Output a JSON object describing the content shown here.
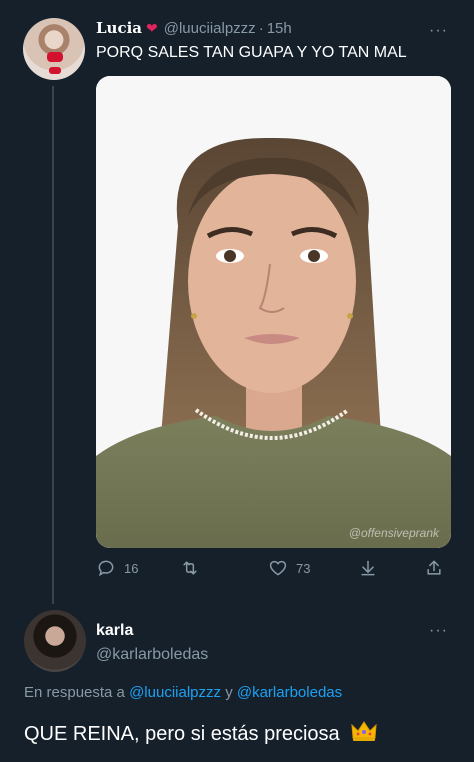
{
  "tweet": {
    "display_name": "Lucia",
    "handle": "@luuciialpzzz",
    "separator": "·",
    "time": "15h",
    "more": "···",
    "text": "PORQ SALES TAN GUAPA Y YO TAN MAL",
    "watermark": "@offensiveprank"
  },
  "actions": {
    "replies": "16",
    "likes": "73"
  },
  "reply": {
    "display_name": "karla",
    "handle": "@karlarboledas",
    "more": "···",
    "in_reply_prefix": "En respuesta a",
    "mention1": "@luuciialpzzz",
    "conjunction": "y",
    "mention2": "@karlarboledas",
    "text": "QUE REINA, pero si estás preciosa"
  },
  "colors": {
    "background": "#15202b",
    "secondary_text": "#8899a6",
    "link": "#1da1f2",
    "thread_line": "#38444d"
  },
  "icons": [
    "heart-emoji-icon",
    "more-icon",
    "reply-icon",
    "retweet-icon",
    "like-icon",
    "bookmark-icon",
    "share-icon",
    "crown-emoji-icon"
  ]
}
